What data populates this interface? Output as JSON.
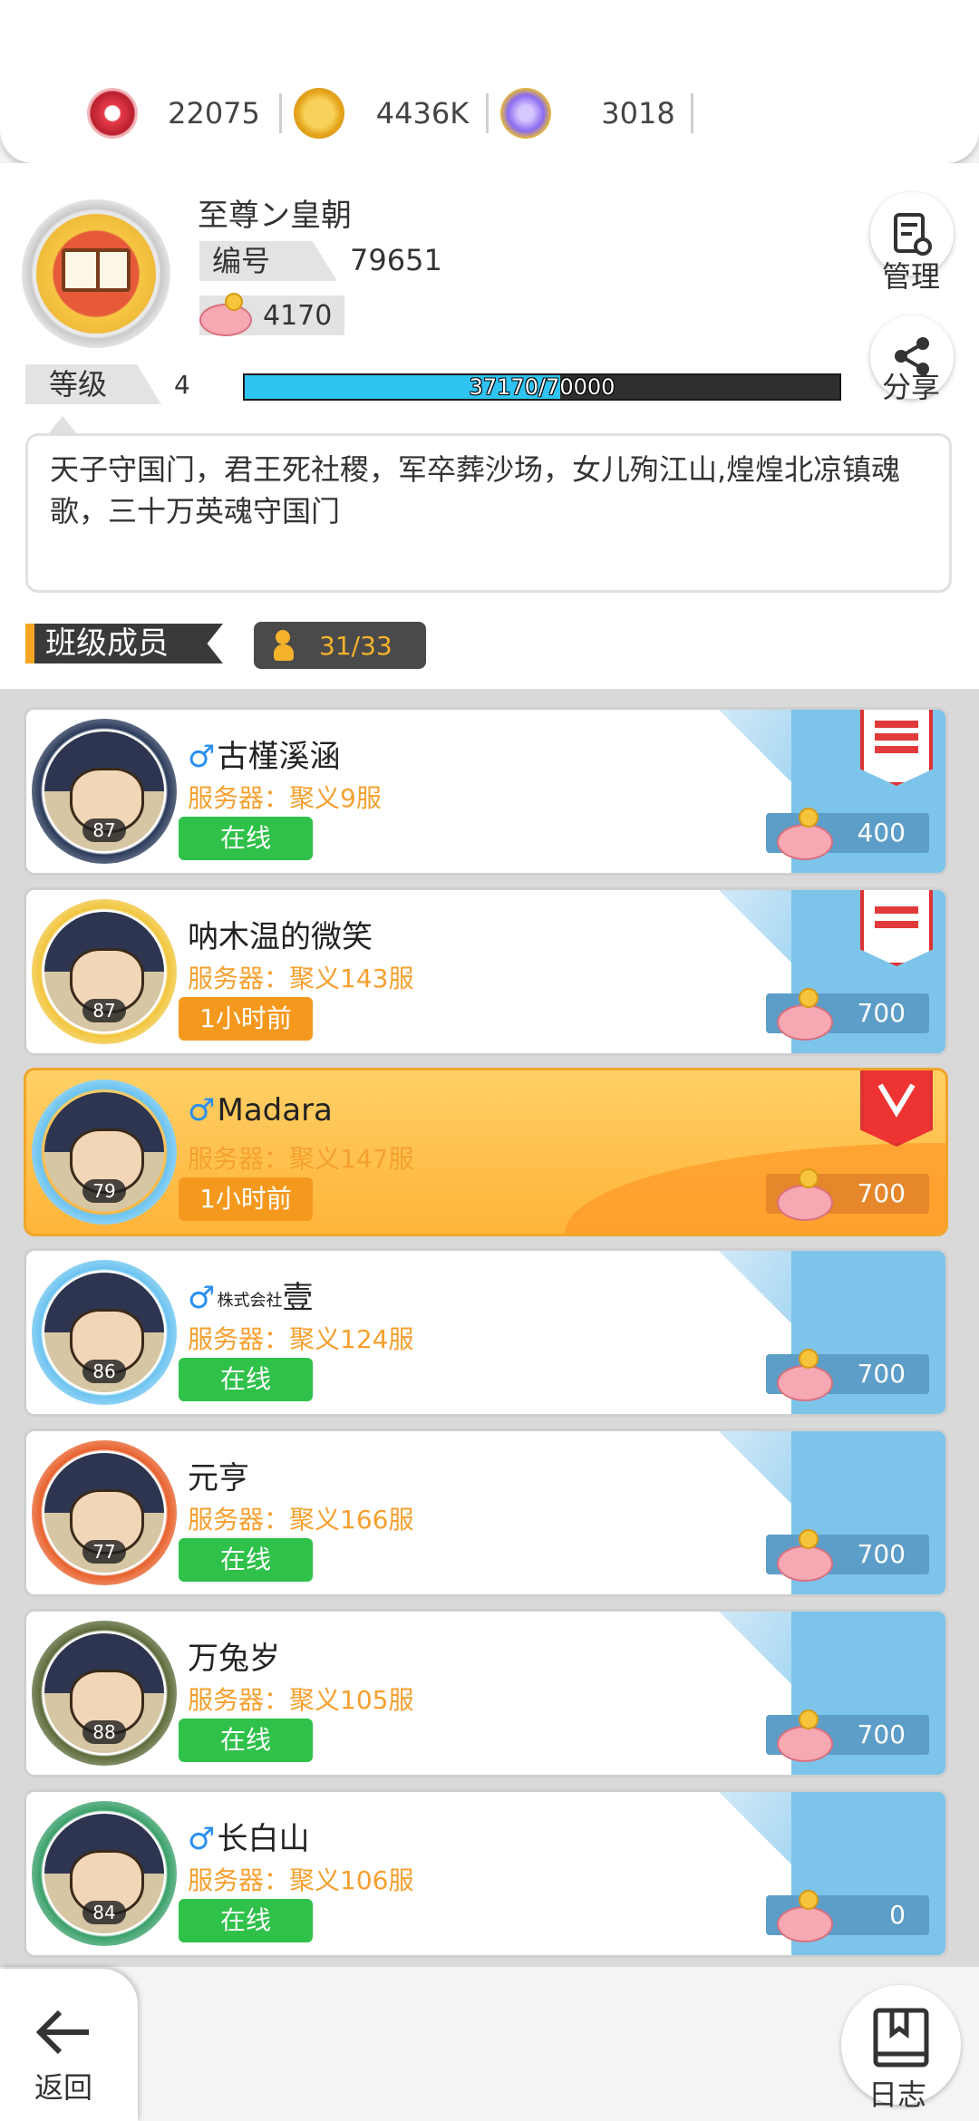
{
  "currencies": [
    {
      "icon": "gem-red-icon",
      "value": "22075",
      "color": "#e63b4a"
    },
    {
      "icon": "gold-coin-icon",
      "value": "4436K",
      "color": "#f2b323"
    },
    {
      "icon": "crystal-pacifier-icon",
      "value": "3018",
      "color": "#8a6cf0"
    }
  ],
  "guild": {
    "name": "至尊ン皇朝",
    "id_label": "编号",
    "id_value": "79651",
    "fund_value": "4170",
    "level_label": "等级",
    "level_value": "4",
    "xp_text": "37170/70000",
    "xp_fraction": 0.531,
    "notice": "天子守国门，君王死社稷，军卒葬沙场，女儿殉江山,煌煌北凉镇魂歌，三十万英魂守国门",
    "manage_label": "管理",
    "share_label": "分享"
  },
  "members_section": {
    "title": "班级成员",
    "count": "31/33"
  },
  "members": [
    {
      "name": "古槿溪涵",
      "male": true,
      "server": "服务器：聚义9服",
      "status": "在线",
      "status_type": "online",
      "level": "87",
      "contribution": "400",
      "badge": "gold",
      "highlight": false
    },
    {
      "name": "呐木温的微笑",
      "male": false,
      "server": "服务器：聚义143服",
      "status": "1小时前",
      "status_type": "away",
      "level": "87",
      "contribution": "700",
      "badge": "silver",
      "highlight": false
    },
    {
      "name": "Madara",
      "male": true,
      "server": "服务器：聚义147服",
      "status": "1小时前",
      "status_type": "away",
      "level": "79",
      "contribution": "700",
      "badge": "bronze",
      "highlight": true
    },
    {
      "name": "壹",
      "male": true,
      "prefix": "株式会社",
      "server": "服务器：聚义124服",
      "status": "在线",
      "status_type": "online",
      "level": "86",
      "contribution": "700",
      "badge": "none",
      "highlight": false
    },
    {
      "name": "元亨",
      "male": false,
      "server": "服务器：聚义166服",
      "status": "在线",
      "status_type": "online",
      "level": "77",
      "contribution": "700",
      "badge": "none",
      "highlight": false
    },
    {
      "name": "万兔岁",
      "male": false,
      "server": "服务器：聚义105服",
      "status": "在线",
      "status_type": "online",
      "level": "88",
      "contribution": "700",
      "badge": "none",
      "highlight": false
    },
    {
      "name": "长白山",
      "male": true,
      "server": "服务器：聚义106服",
      "status": "在线",
      "status_type": "online",
      "level": "84",
      "contribution": "0",
      "badge": "none",
      "highlight": false
    }
  ],
  "footer": {
    "back_label": "返回",
    "log_label": "日志"
  }
}
